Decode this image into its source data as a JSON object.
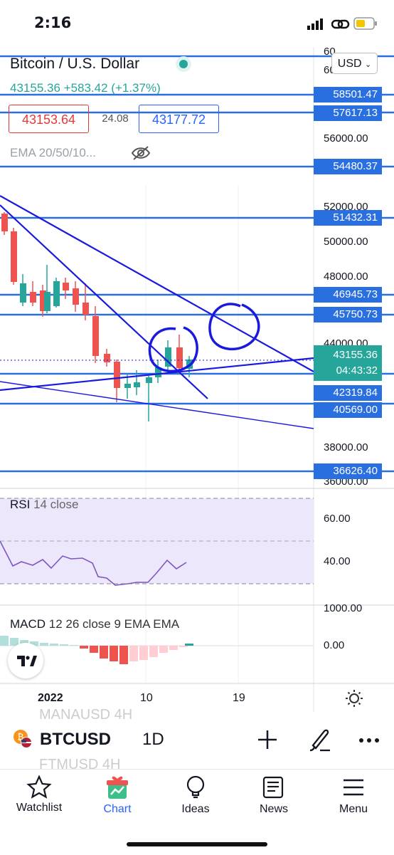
{
  "status_bar": {
    "time": "2:16"
  },
  "chart_header": {
    "symbol_name": "Bitcoin / U.S. Dollar",
    "last_price": "43155.36",
    "change": "+583.42 (+1.37%)",
    "bid": "43153.64",
    "spread": "24.08",
    "ask": "43177.72",
    "indicator_label": "EMA 20/50/10...",
    "currency": "USD"
  },
  "price_axis": {
    "labels": [
      "56000.00",
      "52000.00",
      "50000.00",
      "48000.00",
      "44000.00",
      "38000.00",
      "36000.00"
    ],
    "horizontal_line_tags": [
      "58501.47",
      "57617.13",
      "54480.37",
      "51432.31",
      "46945.73",
      "45750.73",
      "42319.84",
      "40569.00",
      "36626.40"
    ],
    "top_partial_labels": [
      "60",
      "60000.00"
    ],
    "current_price_tag": {
      "price": "43155.36",
      "countdown": "04:43:32"
    }
  },
  "rsi": {
    "label": "RSI",
    "params": "14 close",
    "axis": [
      "60.00",
      "40.00"
    ]
  },
  "macd": {
    "label": "MACD",
    "params": "12 26 close 9 EMA EMA",
    "axis": [
      "1000.00",
      "0.00"
    ]
  },
  "time_axis": {
    "labels": [
      "2022",
      "10",
      "19"
    ]
  },
  "symbol_bar": {
    "symbol": "BTCUSD",
    "interval": "1D",
    "ghost_rows": [
      "MANAUSD 4H",
      "FTMUSD 4H"
    ]
  },
  "bottom_nav": {
    "items": [
      {
        "label": "Watchlist",
        "icon": "star-icon"
      },
      {
        "label": "Chart",
        "icon": "gift-chart-icon"
      },
      {
        "label": "Ideas",
        "icon": "lightbulb-icon"
      },
      {
        "label": "News",
        "icon": "news-icon"
      },
      {
        "label": "Menu",
        "icon": "hamburger-icon"
      }
    ],
    "active": "Chart"
  },
  "colors": {
    "up": "#26a69a",
    "down": "#ef5350",
    "level_line": "#2a6fe0",
    "drawing": "#1a1adf",
    "accent": "#2962ff"
  }
}
